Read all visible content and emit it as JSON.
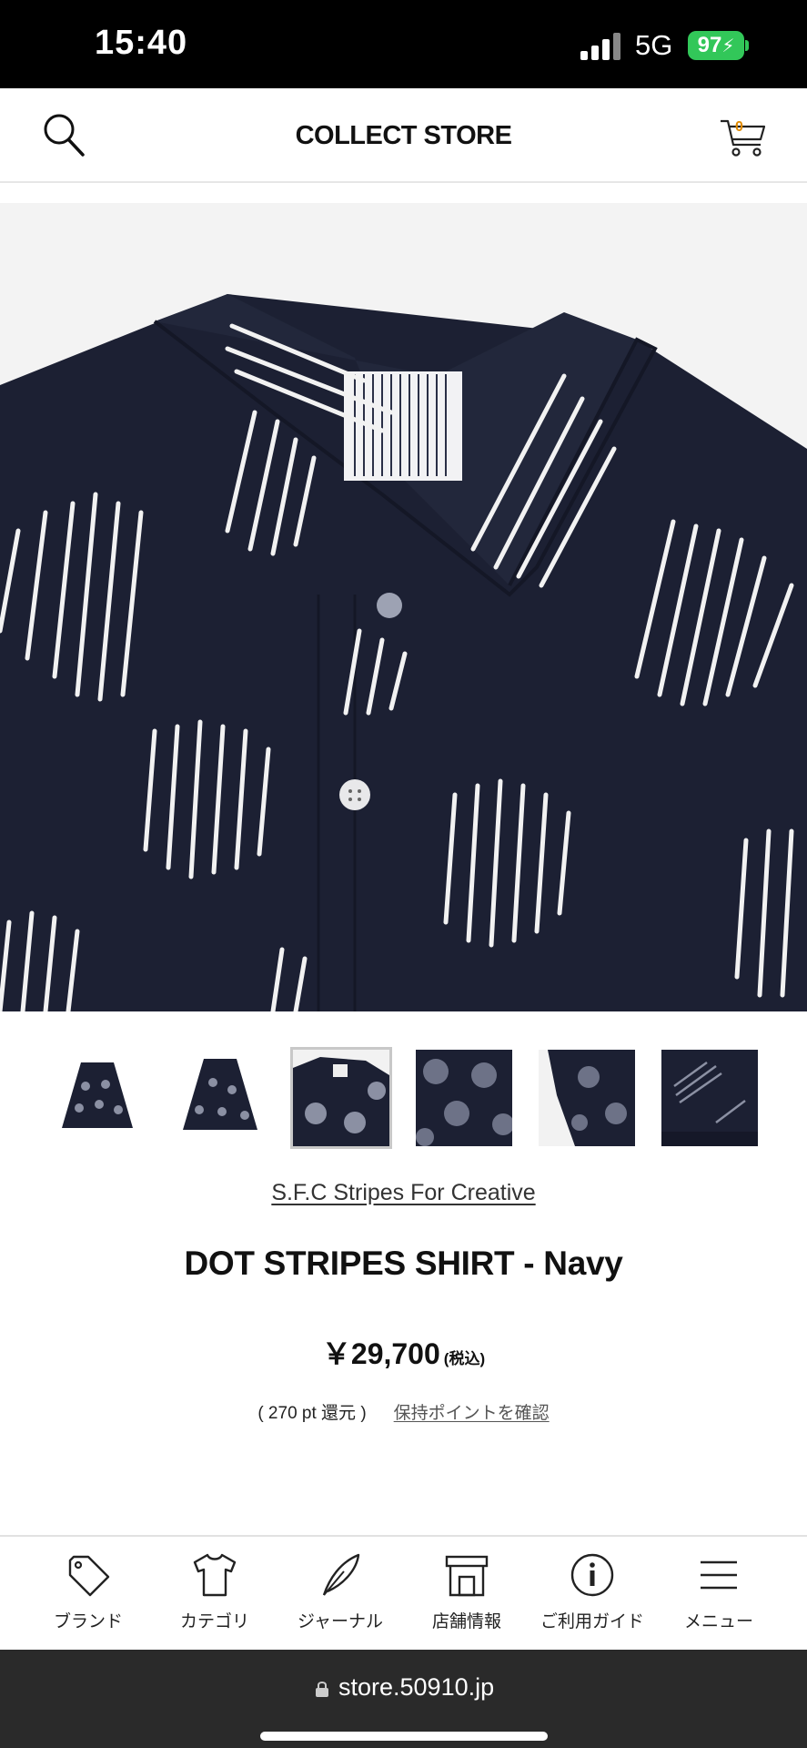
{
  "status_bar": {
    "time": "15:40",
    "network": "5G",
    "battery": "97"
  },
  "header": {
    "title": "COLLECT STORE",
    "cart_count": "0"
  },
  "product": {
    "brand_link": "S.F.C Stripes For Creative",
    "name": "DOT STRIPES SHIRT - Navy",
    "price": "￥29,700",
    "tax_note": "(税込)",
    "points": "( 270 pt 還元 )",
    "points_link": "保持ポイントを確認",
    "selected_thumbnail": 3,
    "thumbnail_count": 6
  },
  "bottom_nav": [
    {
      "label": "ブランド",
      "icon": "tag-icon"
    },
    {
      "label": "カテゴリ",
      "icon": "tshirt-icon"
    },
    {
      "label": "ジャーナル",
      "icon": "feather-pen-icon"
    },
    {
      "label": "店舗情報",
      "icon": "store-icon"
    },
    {
      "label": "ご利用ガイド",
      "icon": "info-icon"
    },
    {
      "label": "メニュー",
      "icon": "hamburger-menu-icon"
    }
  ],
  "url_bar": {
    "url": "store.50910.jp"
  },
  "colors": {
    "shirt_navy": "#1c2033",
    "battery_green": "#32c759",
    "cart_badge": "#e08a00"
  }
}
